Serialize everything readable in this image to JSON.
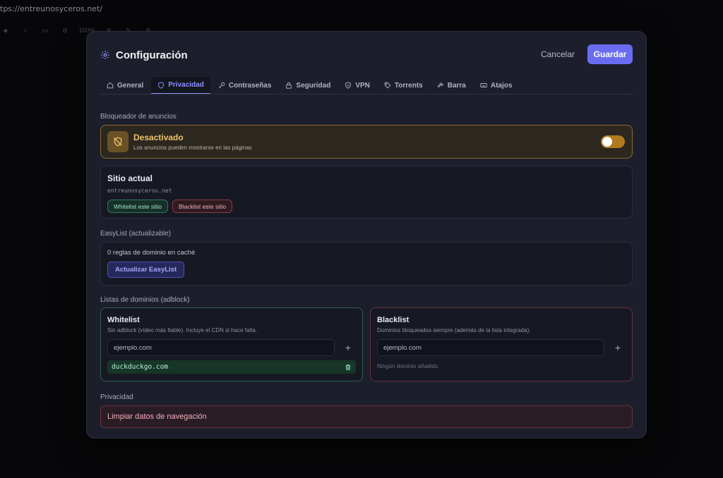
{
  "browser": {
    "url": "tps://entreunosyceros.net/",
    "zoom": "100%"
  },
  "modal": {
    "title": "Configuración",
    "cancel": "Cancelar",
    "save": "Guardar"
  },
  "tabs": [
    {
      "label": "General",
      "icon": "home-icon"
    },
    {
      "label": "Privacidad",
      "icon": "shield-icon",
      "active": true
    },
    {
      "label": "Contraseñas",
      "icon": "key-icon"
    },
    {
      "label": "Seguridad",
      "icon": "lock-icon"
    },
    {
      "label": "VPN",
      "icon": "shield-check-icon"
    },
    {
      "label": "Torrents",
      "icon": "tag-icon"
    },
    {
      "label": "Barra",
      "icon": "hammer-icon"
    },
    {
      "label": "Atajos",
      "icon": "keyboard-icon"
    }
  ],
  "adblock": {
    "section": "Bloqueador de anuncios",
    "status": "Desactivado",
    "description": "Los anuncios pueden mostrarse en las páginas",
    "enabled": false
  },
  "site": {
    "title": "Sitio actual",
    "domain": "entreunosyceros.net",
    "whitelist_btn": "Whitelist este sitio",
    "blacklist_btn": "Blacklist este sitio"
  },
  "easylist": {
    "section": "EasyList (actualizable)",
    "rules": "0 reglas de dominio en caché",
    "update_btn": "Actualizar EasyList"
  },
  "lists": {
    "section": "Listas de dominios (adblock)",
    "whitelist": {
      "title": "Whitelist",
      "description": "Sin adblock (vídeo más fiable). Incluye el CDN si hace falta.",
      "placeholder": "ejemplo.com",
      "entries": [
        "duckduckgo.com"
      ]
    },
    "blacklist": {
      "title": "Blacklist",
      "description": "Dominios bloqueados siempre (además de la lista integrada).",
      "placeholder": "ejemplo.com",
      "empty": "Ningún dominio añadido"
    }
  },
  "privacy": {
    "section": "Privacidad",
    "clear_btn": "Limpiar datos de navegación"
  },
  "colors": {
    "accent": "#6a6cf0",
    "warning": "#f0c36a",
    "success": "#2f7a58",
    "danger": "#8a3a46"
  }
}
